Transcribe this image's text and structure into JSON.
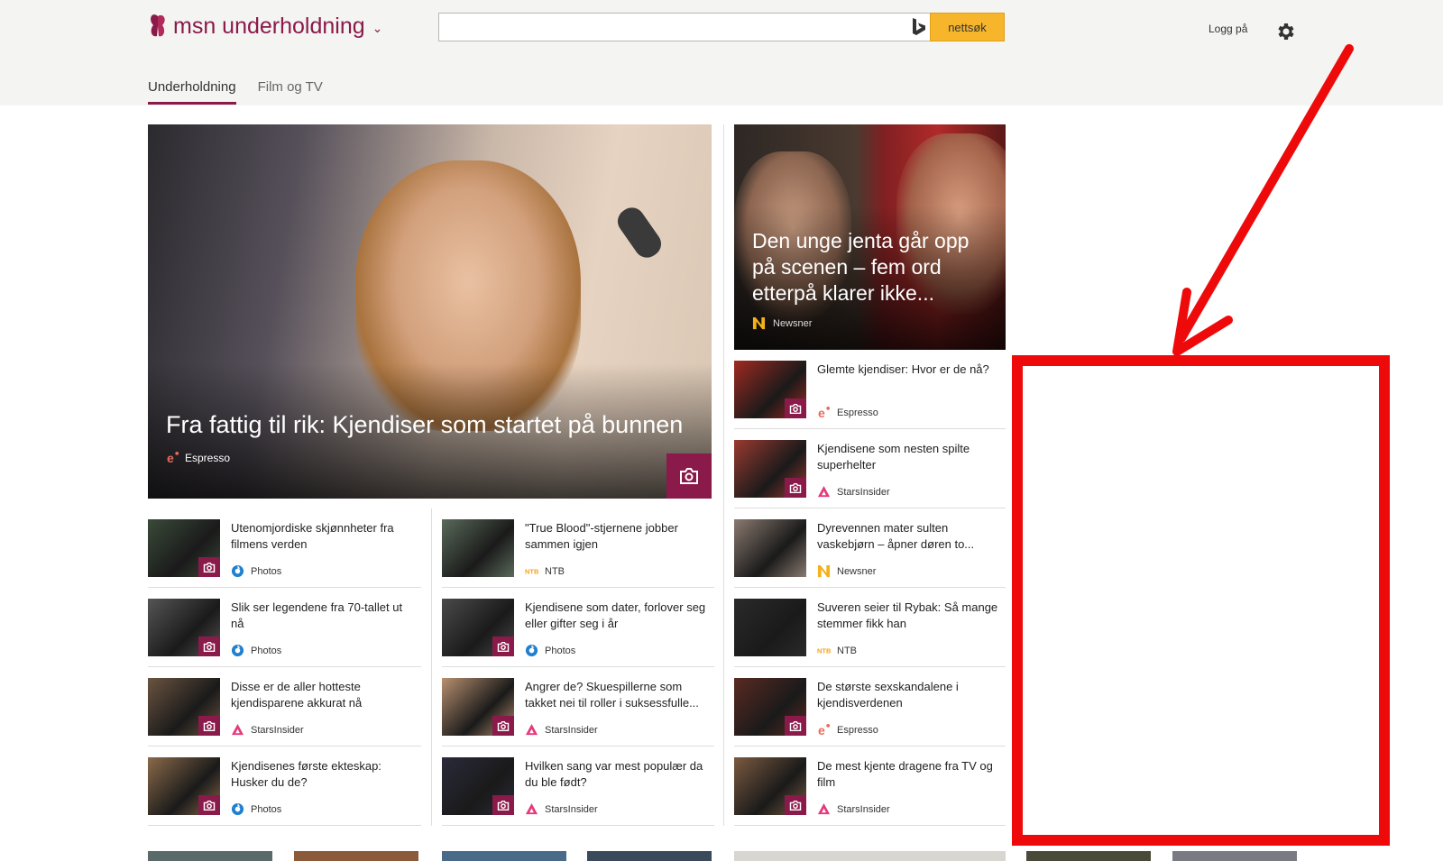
{
  "header": {
    "brand": "msn underholdning",
    "search_placeholder": "",
    "search_button": "nettsøk",
    "login": "Logg på"
  },
  "nav": {
    "tabs": [
      {
        "label": "Underholdning",
        "active": true
      },
      {
        "label": "Film og TV",
        "active": false
      }
    ]
  },
  "hero": {
    "title": "Fra fattig til rik: Kjendiser som startet på bunnen",
    "source": "Espresso"
  },
  "feature": {
    "title": "Den unge jenta går opp på scenen – fem ord etterpå klarer ikke...",
    "source": "Newsner"
  },
  "col1": [
    {
      "title": "Utenomjordiske skjønnheter fra filmens verden",
      "source": "Photos",
      "icon": "photos",
      "color": "#3a4a3a"
    },
    {
      "title": "Slik ser legendene fra 70-tallet ut nå",
      "source": "Photos",
      "icon": "photos",
      "color": "#555"
    },
    {
      "title": "Disse er de aller hotteste kjendisparene akkurat nå",
      "source": "StarsInsider",
      "icon": "stars",
      "color": "#6a5440"
    },
    {
      "title": "Kjendisenes første ekteskap: Husker du de?",
      "source": "Photos",
      "icon": "photos",
      "color": "#8a6a4a"
    }
  ],
  "col2": [
    {
      "title": "\"True Blood\"-stjernene jobber sammen igjen",
      "source": "NTB",
      "icon": "ntb",
      "color": "#5a6a5a"
    },
    {
      "title": "Kjendisene som dater, forlover seg eller gifter seg i år",
      "source": "Photos",
      "icon": "photos",
      "color": "#4a4a4a"
    },
    {
      "title": "Angrer de? Skuespillerne som takket nei til roller i suksessfulle...",
      "source": "StarsInsider",
      "icon": "stars",
      "color": "#b89070"
    },
    {
      "title": "Hvilken sang var mest populær da du ble født?",
      "source": "StarsInsider",
      "icon": "stars",
      "color": "#2a2a3a"
    }
  ],
  "col3": [
    {
      "title": "Glemte kjendiser: Hvor er de nå?",
      "source": "Espresso",
      "icon": "espresso",
      "color": "#a02a20"
    },
    {
      "title": "Kjendisene som nesten spilte superhelter",
      "source": "StarsInsider",
      "icon": "stars",
      "color": "#9a3a30"
    },
    {
      "title": "Dyrevennen mater sulten vaskebjørn – åpner døren to...",
      "source": "Newsner",
      "icon": "newsner",
      "color": "#8a7a70"
    },
    {
      "title": "Suveren seier til Rybak: Så mange stemmer fikk han",
      "source": "NTB",
      "icon": "ntb",
      "color": "#2a2a2a"
    },
    {
      "title": "De største sexskandalene i kjendisverdenen",
      "source": "Espresso",
      "icon": "espresso",
      "color": "#5a2a22"
    },
    {
      "title": "De mest kjente dragene fra TV og film",
      "source": "StarsInsider",
      "icon": "stars",
      "color": "#7a5a40"
    }
  ],
  "colors": {
    "brand": "#8a1a4a",
    "search_button": "#f6b52a",
    "annotation": "#ee0a0a"
  }
}
